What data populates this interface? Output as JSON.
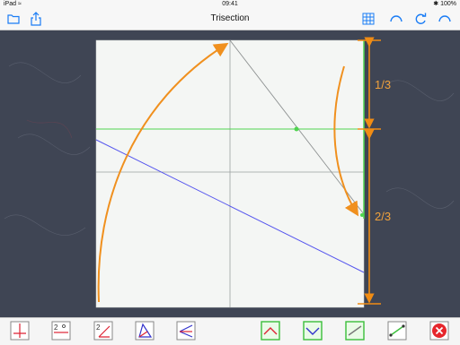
{
  "status_bar": {
    "carrier": "iPad ≈",
    "time": "09:41",
    "battery": "✱ 100%"
  },
  "nav": {
    "title": "Trisection",
    "left_icons": [
      "folder-icon",
      "share-icon"
    ],
    "right_icons": [
      "grid-icon",
      "undo-icon",
      "refresh-icon",
      "redo-icon"
    ]
  },
  "measure": {
    "upper_label": "1/3",
    "lower_label": "2/3"
  },
  "colors": {
    "paper": "#f4f6f4",
    "fold_line_gray": "#9aa0a0",
    "green_line": "#4fd44f",
    "blue_line": "#5555ee",
    "arrow_orange": "#f0901e",
    "dimension_orange": "#f08c14",
    "close_red": "#e6262c"
  },
  "toolbar": {
    "tools": [
      "perpendicular-fold-tool",
      "halve-fold-tool",
      "angle-fold-tool",
      "triangle-fold-tool",
      "bisector-fold-tool",
      "mountain-fold-tool",
      "valley-fold-tool",
      "line-tool",
      "point-line-tool",
      "close-tool"
    ]
  }
}
